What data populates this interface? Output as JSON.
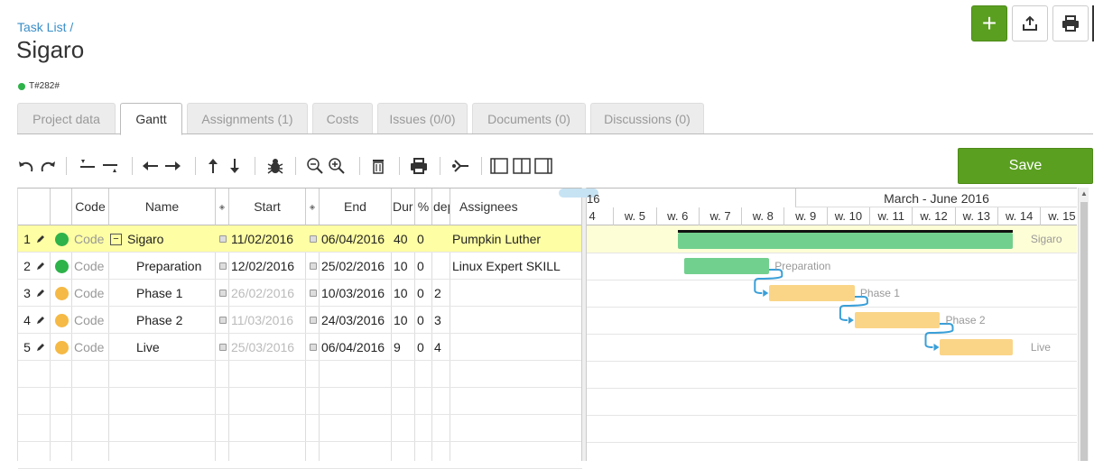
{
  "breadcrumb": "Task List /",
  "project_title": "Sigaro",
  "project_code": "T#282#",
  "actions": {
    "add_icon": "plus-icon",
    "export_icon": "export-icon",
    "print_icon": "print-icon"
  },
  "tabs": [
    {
      "label": "Project data",
      "active": false
    },
    {
      "label": "Gantt",
      "active": true
    },
    {
      "label": "Assignments (1)",
      "active": false
    },
    {
      "label": "Costs",
      "active": false
    },
    {
      "label": "Issues (0/0)",
      "active": false
    },
    {
      "label": "Documents (0)",
      "active": false
    },
    {
      "label": "Discussions (0)",
      "active": false
    }
  ],
  "toolbar": {
    "icons": [
      "undo-icon",
      "redo-icon",
      "insert-above-icon",
      "insert-below-icon",
      "outdent-icon",
      "indent-icon",
      "move-up-icon",
      "move-down-icon",
      "bug-icon",
      "zoom-out-icon",
      "zoom-in-icon",
      "delete-icon",
      "print-icon",
      "critical-path-icon",
      "split-left-icon",
      "split-middle-icon",
      "split-right-icon"
    ],
    "save_label": "Save"
  },
  "grid": {
    "headers": {
      "code": "Code",
      "name": "Name",
      "start": "Start",
      "end": "End",
      "dur": "Dur",
      "pct": "%",
      "dep": "dep",
      "assignees": "Assignees"
    },
    "rows": [
      {
        "num": "1",
        "status": "green",
        "code": "Code",
        "name": "Sigaro",
        "collapse": "−",
        "start": "11/02/2016",
        "start_muted": false,
        "end": "06/04/2016",
        "dur": "40",
        "pct": "0",
        "dep": "",
        "assignees": "Pumpkin Luther"
      },
      {
        "num": "2",
        "status": "green",
        "code": "Code",
        "name": "Preparation",
        "collapse": "",
        "start": "12/02/2016",
        "start_muted": false,
        "end": "25/02/2016",
        "dur": "10",
        "pct": "0",
        "dep": "",
        "assignees": "Linux Expert SKILL"
      },
      {
        "num": "3",
        "status": "yellow",
        "code": "Code",
        "name": "Phase 1",
        "collapse": "",
        "start": "26/02/2016",
        "start_muted": true,
        "end": "10/03/2016",
        "dur": "10",
        "pct": "0",
        "dep": "2",
        "assignees": ""
      },
      {
        "num": "4",
        "status": "yellow",
        "code": "Code",
        "name": "Phase 2",
        "collapse": "",
        "start": "11/03/2016",
        "start_muted": true,
        "end": "24/03/2016",
        "dur": "10",
        "pct": "0",
        "dep": "3",
        "assignees": ""
      },
      {
        "num": "5",
        "status": "yellow",
        "code": "Code",
        "name": "Live",
        "collapse": "",
        "start": "25/03/2016",
        "start_muted": true,
        "end": "06/04/2016",
        "dur": "9",
        "pct": "0",
        "dep": "4",
        "assignees": ""
      }
    ]
  },
  "gantt": {
    "prev_period": "16",
    "period": "March - June 2016",
    "weeks": [
      "4",
      "w. 5",
      "w. 6",
      "w. 7",
      "w. 8",
      "w. 9",
      "w. 10",
      "w. 11",
      "w. 12",
      "w. 13",
      "w. 14",
      "w. 15"
    ],
    "bars": [
      {
        "label": "Sigaro",
        "start_week": 6.0,
        "end_week": 13.85,
        "color": "#72d08e",
        "summary": true
      },
      {
        "label": "Preparation",
        "start_week": 6.15,
        "end_week": 8.15,
        "color": "#72d08e",
        "summary": false
      },
      {
        "label": "Phase 1",
        "start_week": 8.15,
        "end_week": 10.15,
        "color": "#fad588",
        "summary": false
      },
      {
        "label": "Phase 2",
        "start_week": 10.15,
        "end_week": 12.15,
        "color": "#fad588",
        "summary": false
      },
      {
        "label": "Live",
        "start_week": 12.15,
        "end_week": 13.85,
        "color": "#fad588",
        "summary": false
      }
    ]
  },
  "colors": {
    "accent": "#5b9f21",
    "link": "#3a8fc7",
    "green": "#2eb24a",
    "yellow": "#f5b945",
    "highlight": "#fefea4"
  }
}
